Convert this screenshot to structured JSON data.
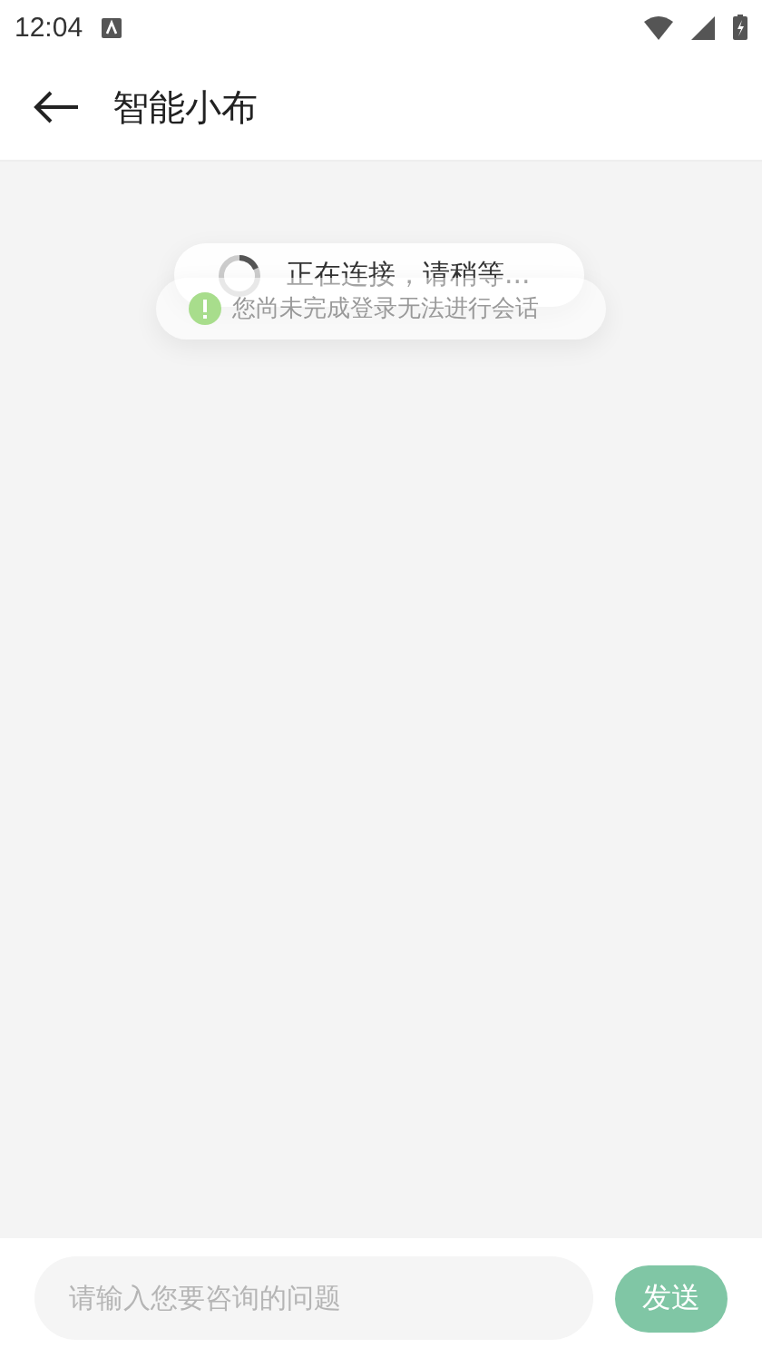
{
  "status_bar": {
    "time": "12:04"
  },
  "app_bar": {
    "title": "智能小布"
  },
  "toasts": [
    {
      "kind": "loading",
      "text": "正在连接，请稍等..."
    },
    {
      "kind": "warning",
      "text": "您尚未完成登录无法进行会话"
    }
  ],
  "input": {
    "placeholder": "请输入您要咨询的问题"
  },
  "send_button": {
    "label": "发送"
  }
}
